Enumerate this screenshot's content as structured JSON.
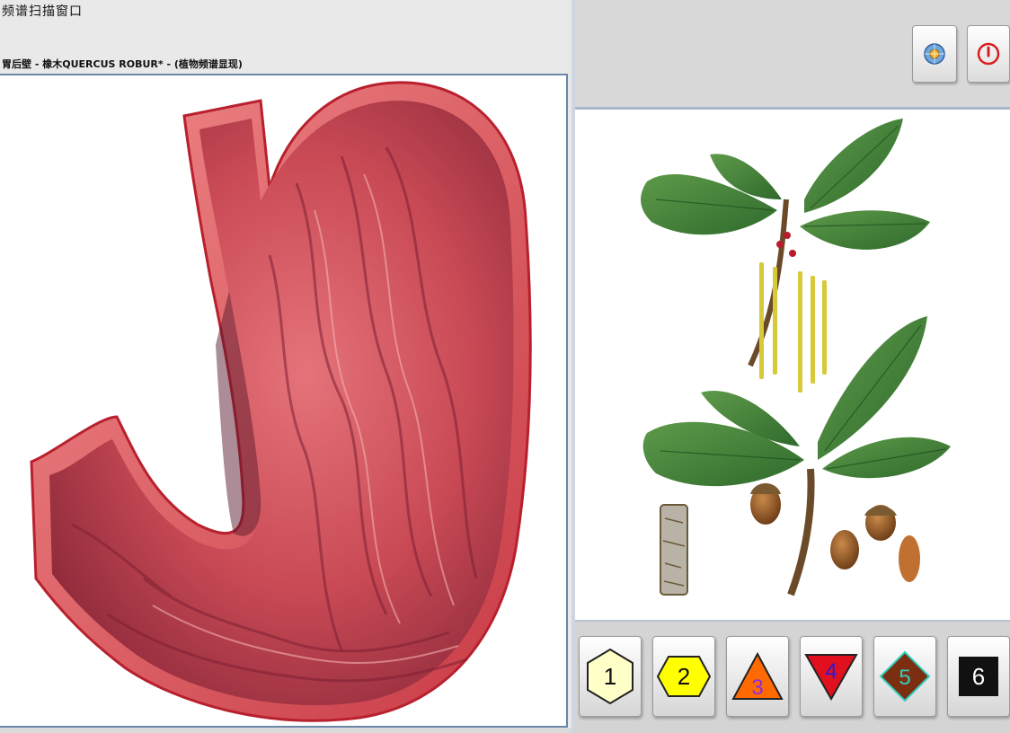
{
  "window": {
    "title": "频谱扫描窗口",
    "subtitle": "胃后壁 - 橡木QUERCUS ROBUR* - (植物频谱显现)"
  },
  "images": {
    "left": "stomach-anatomy-illustration",
    "right": "oak-quercus-robur-botanical-illustration"
  },
  "toolbar": {
    "settings_icon": "globe-settings-icon",
    "power_icon": "power-icon",
    "power_color": "#d81e1e"
  },
  "levels": [
    {
      "label": "1",
      "shape": "hexagon",
      "fill": "#ffffc8",
      "text_color": "#111111"
    },
    {
      "label": "2",
      "shape": "hexagon",
      "fill": "#ffff00",
      "text_color": "#111111"
    },
    {
      "label": "3",
      "shape": "triangle-up",
      "fill": "#ff6a00",
      "text_color": "#8a2be2"
    },
    {
      "label": "4",
      "shape": "triangle-down",
      "fill": "#e0101e",
      "text_color": "#2a1bd6"
    },
    {
      "label": "5",
      "shape": "diamond",
      "fill": "#7b2e10",
      "text_color": "#30d0c0"
    },
    {
      "label": "6",
      "shape": "square",
      "fill": "#111111",
      "text_color": "#ffffff"
    }
  ]
}
